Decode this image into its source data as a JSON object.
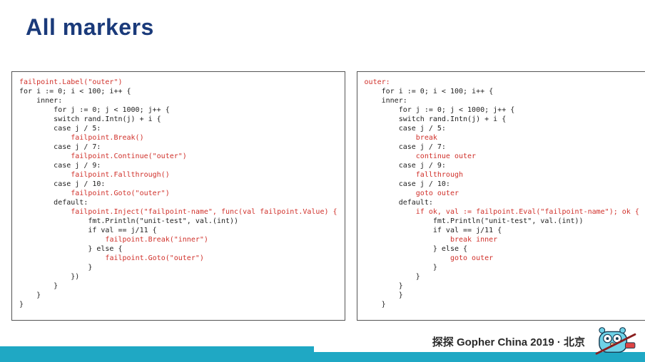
{
  "title": "All markers",
  "footer": "探探 Gopher China 2019 · 北京",
  "code_left": [
    {
      "indent": 0,
      "tokens": [
        {
          "t": "failpoint.Label(\"outer\")",
          "hl": true
        }
      ]
    },
    {
      "indent": 0,
      "tokens": [
        {
          "t": "for i := 0; i < 100; i++ {",
          "hl": false
        }
      ]
    },
    {
      "indent": 1,
      "tokens": [
        {
          "t": "inner:",
          "hl": false
        }
      ]
    },
    {
      "indent": 2,
      "tokens": [
        {
          "t": "for j := 0; j < 1000; j++ {",
          "hl": false
        }
      ]
    },
    {
      "indent": 2,
      "tokens": [
        {
          "t": "switch rand.Intn(j) + i {",
          "hl": false
        }
      ]
    },
    {
      "indent": 2,
      "tokens": [
        {
          "t": "case j / 5:",
          "hl": false
        }
      ]
    },
    {
      "indent": 3,
      "tokens": [
        {
          "t": "failpoint.Break()",
          "hl": true
        }
      ]
    },
    {
      "indent": 2,
      "tokens": [
        {
          "t": "case j / 7:",
          "hl": false
        }
      ]
    },
    {
      "indent": 3,
      "tokens": [
        {
          "t": "failpoint.Continue(\"outer\")",
          "hl": true
        }
      ]
    },
    {
      "indent": 2,
      "tokens": [
        {
          "t": "case j / 9:",
          "hl": false
        }
      ]
    },
    {
      "indent": 3,
      "tokens": [
        {
          "t": "failpoint.Fallthrough()",
          "hl": true
        }
      ]
    },
    {
      "indent": 2,
      "tokens": [
        {
          "t": "case j / 10:",
          "hl": false
        }
      ]
    },
    {
      "indent": 3,
      "tokens": [
        {
          "t": "failpoint.Goto(\"outer\")",
          "hl": true
        }
      ]
    },
    {
      "indent": 2,
      "tokens": [
        {
          "t": "default:",
          "hl": false
        }
      ]
    },
    {
      "indent": 3,
      "tokens": [
        {
          "t": "failpoint.Inject(\"failpoint-name\", func(val failpoint.Value) {",
          "hl": true
        }
      ]
    },
    {
      "indent": 4,
      "tokens": [
        {
          "t": "fmt.Println(\"unit-test\", val.(int))",
          "hl": false
        }
      ]
    },
    {
      "indent": 4,
      "tokens": [
        {
          "t": "if val == j/11 {",
          "hl": false
        }
      ]
    },
    {
      "indent": 5,
      "tokens": [
        {
          "t": "failpoint.Break(\"inner\")",
          "hl": true
        }
      ]
    },
    {
      "indent": 4,
      "tokens": [
        {
          "t": "} else {",
          "hl": false
        }
      ]
    },
    {
      "indent": 5,
      "tokens": [
        {
          "t": "failpoint.Goto(\"outer\")",
          "hl": true
        }
      ]
    },
    {
      "indent": 4,
      "tokens": [
        {
          "t": "}",
          "hl": false
        }
      ]
    },
    {
      "indent": 3,
      "tokens": [
        {
          "t": "})",
          "hl": false
        }
      ]
    },
    {
      "indent": 2,
      "tokens": [
        {
          "t": "}",
          "hl": false
        }
      ]
    },
    {
      "indent": 1,
      "tokens": [
        {
          "t": "}",
          "hl": false
        }
      ]
    },
    {
      "indent": 0,
      "tokens": [
        {
          "t": "}",
          "hl": false
        }
      ]
    }
  ],
  "code_right": [
    {
      "indent": 0,
      "tokens": [
        {
          "t": "outer:",
          "hl": true
        }
      ]
    },
    {
      "indent": 1,
      "tokens": [
        {
          "t": "for i := 0; i < 100; i++ {",
          "hl": false
        }
      ]
    },
    {
      "indent": 1,
      "tokens": [
        {
          "t": "inner:",
          "hl": false
        }
      ]
    },
    {
      "indent": 2,
      "tokens": [
        {
          "t": "for j := 0; j < 1000; j++ {",
          "hl": false
        }
      ]
    },
    {
      "indent": 2,
      "tokens": [
        {
          "t": "switch rand.Intn(j) + i {",
          "hl": false
        }
      ]
    },
    {
      "indent": 2,
      "tokens": [
        {
          "t": "case j / 5:",
          "hl": false
        }
      ]
    },
    {
      "indent": 3,
      "tokens": [
        {
          "t": "break",
          "hl": true
        }
      ]
    },
    {
      "indent": 2,
      "tokens": [
        {
          "t": "case j / 7:",
          "hl": false
        }
      ]
    },
    {
      "indent": 3,
      "tokens": [
        {
          "t": "continue outer",
          "hl": true
        }
      ]
    },
    {
      "indent": 2,
      "tokens": [
        {
          "t": "case j / 9:",
          "hl": false
        }
      ]
    },
    {
      "indent": 3,
      "tokens": [
        {
          "t": "fallthrough",
          "hl": true
        }
      ]
    },
    {
      "indent": 2,
      "tokens": [
        {
          "t": "case j / 10:",
          "hl": false
        }
      ]
    },
    {
      "indent": 3,
      "tokens": [
        {
          "t": "goto outer",
          "hl": true
        }
      ]
    },
    {
      "indent": 2,
      "tokens": [
        {
          "t": "default:",
          "hl": false
        }
      ]
    },
    {
      "indent": 3,
      "tokens": [
        {
          "t": "if ok, val := failpoint.Eval(\"failpoint-name\"); ok {",
          "hl": true
        }
      ]
    },
    {
      "indent": 4,
      "tokens": [
        {
          "t": "fmt.Println(\"unit-test\", val.(int))",
          "hl": false
        }
      ]
    },
    {
      "indent": 4,
      "tokens": [
        {
          "t": "if val == j/11 {",
          "hl": false
        }
      ]
    },
    {
      "indent": 5,
      "tokens": [
        {
          "t": "break inner",
          "hl": true
        }
      ]
    },
    {
      "indent": 4,
      "tokens": [
        {
          "t": "} else {",
          "hl": false
        }
      ]
    },
    {
      "indent": 5,
      "tokens": [
        {
          "t": "goto outer",
          "hl": true
        }
      ]
    },
    {
      "indent": 4,
      "tokens": [
        {
          "t": "}",
          "hl": false
        }
      ]
    },
    {
      "indent": 3,
      "tokens": [
        {
          "t": "}",
          "hl": false
        }
      ]
    },
    {
      "indent": 2,
      "tokens": [
        {
          "t": "}",
          "hl": false
        }
      ]
    },
    {
      "indent": 2,
      "tokens": [
        {
          "t": "}",
          "hl": false
        }
      ]
    },
    {
      "indent": 1,
      "tokens": [
        {
          "t": "}",
          "hl": false
        }
      ]
    }
  ]
}
